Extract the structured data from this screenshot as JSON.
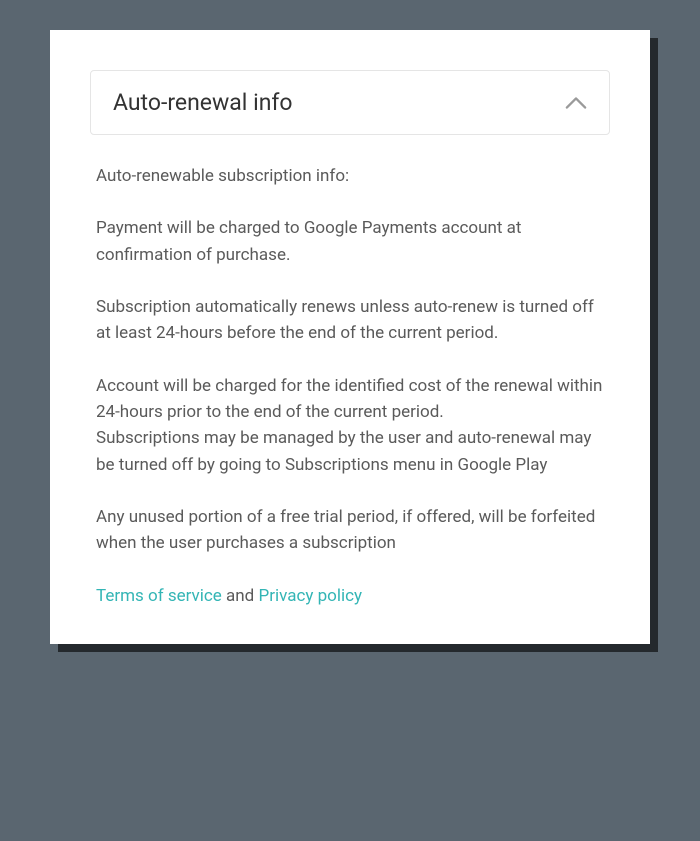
{
  "accordion": {
    "title": "Auto-renewal info"
  },
  "content": {
    "intro": "Auto-renewable subscription info:",
    "p1": "Payment will be charged to Google Payments account at confirmation of purchase.",
    "p2": "Subscription automatically renews unless auto-renew is turned off at least 24-hours before the end of the current period.",
    "p3": "Account will be charged for the identified cost of the renewal within 24-hours prior to the end of the current period.",
    "p4": "Subscriptions may be managed by the user and auto-renewal may be turned off by going to Subscriptions menu in Google Play",
    "p5": "Any unused portion of a free trial period, if offered, will be forfeited when the user purchases a subscription"
  },
  "links": {
    "terms": "Terms of service",
    "and": " and ",
    "privacy": "Privacy policy"
  }
}
